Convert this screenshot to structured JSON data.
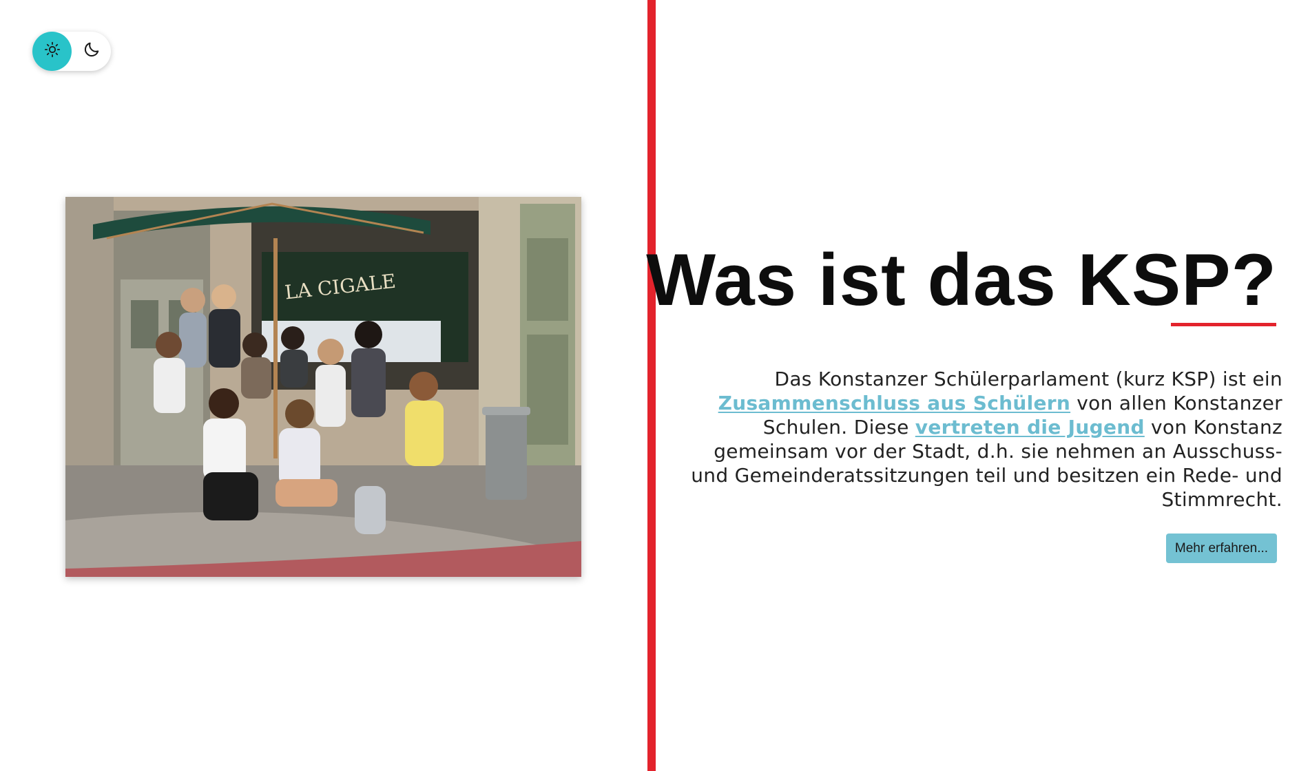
{
  "theme_toggle": {
    "light_icon": "sun-icon",
    "dark_icon": "moon-icon",
    "active": "light"
  },
  "photo": {
    "alt": "LA CIGALE",
    "sign_text": "LA CIGALE"
  },
  "section": {
    "title": "Was ist das KSP?",
    "text_1": "Das Konstanzer Schülerparlament (kurz KSP) ist ein ",
    "link_1": "Zusammenschluss aus Schülern",
    "text_2": " von allen Konstanzer Schulen. Diese ",
    "link_2": "vertreten die Jugend",
    "text_3": " von Konstanz gemeinsam vor der Stadt, d.h. sie nehmen an Ausschuss- und Gemeinderatssitzungen teil und besitzen ein Rede- und Stimmrecht.",
    "button_label": "Mehr erfahren..."
  },
  "colors": {
    "accent_red": "#e3232c",
    "toggle_active": "#29c3c9",
    "link": "#6cbcd0",
    "button_bg": "#74c2d3"
  }
}
